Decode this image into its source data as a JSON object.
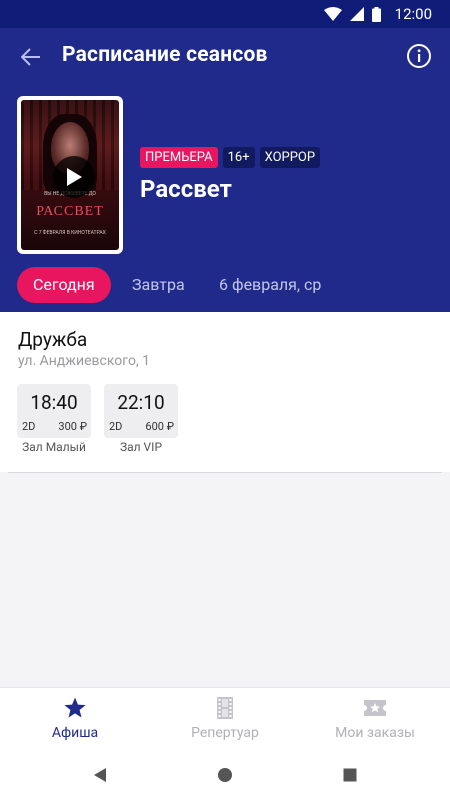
{
  "status_bar": {
    "time": "12:00"
  },
  "app_bar": {
    "title": "Расписание сеансов"
  },
  "movie": {
    "badges": [
      "ПРЕМЬЕРА",
      "16+",
      "ХОРРОР"
    ],
    "title": "Рассвет",
    "poster": {
      "title": "РАССВЕТ",
      "tagline": "ВЫ НЕ ДОЖИВЕТЕ ДО",
      "date": "С 7 ФЕВРАЛЯ В КИНОТЕАТРАХ"
    }
  },
  "date_tabs": [
    "Сегодня",
    "Завтра",
    "6 февраля, ср"
  ],
  "cinema": {
    "name": "Дружба",
    "address": "ул. Анджиевского, 1",
    "sessions": [
      {
        "time": "18:40",
        "format": "2D",
        "price": "300 ₽",
        "hall": "Зал Малый"
      },
      {
        "time": "22:10",
        "format": "2D",
        "price": "600 ₽",
        "hall": "Зал VIP"
      }
    ]
  },
  "bottom_nav": [
    {
      "label": "Афиша",
      "icon": "star-icon",
      "active": true
    },
    {
      "label": "Репертуар",
      "icon": "film-icon",
      "active": false
    },
    {
      "label": "Мои заказы",
      "icon": "ticket-icon",
      "active": false
    }
  ],
  "colors": {
    "header": "#1f2a8a",
    "accent": "#e8165f",
    "status_bar": "#101d78"
  }
}
